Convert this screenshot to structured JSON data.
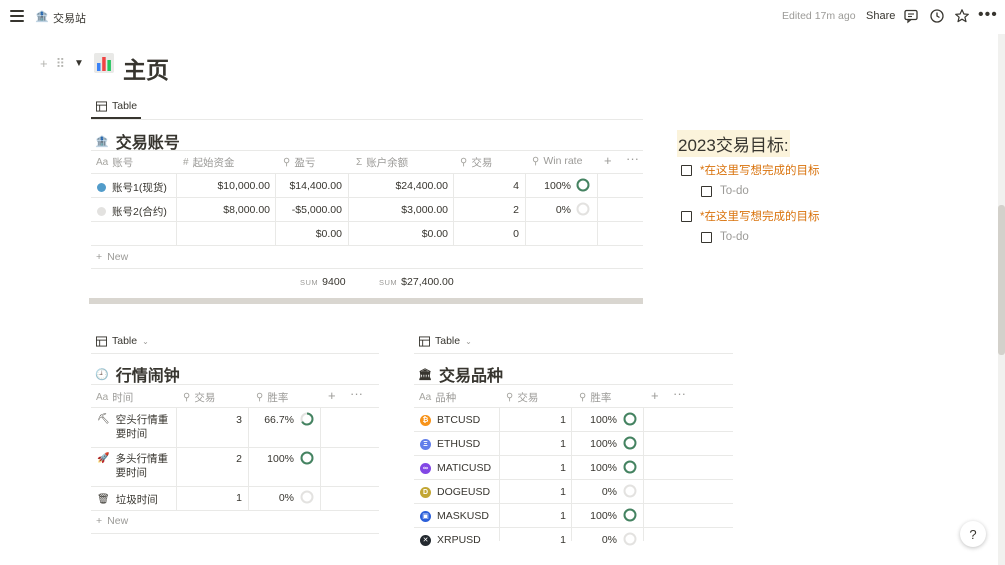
{
  "topbar": {
    "breadcrumb": "交易站",
    "edited": "Edited 17m ago",
    "share": "Share",
    "icons": [
      "menu-icon",
      "comment-icon",
      "clock-icon",
      "star-icon",
      "more-icon"
    ]
  },
  "page": {
    "icon": "bar-chart-icon",
    "title": "主页"
  },
  "accounts": {
    "view_label": "Table",
    "title": "交易账号",
    "columns": [
      "账号",
      "起始资金",
      "盈亏",
      "账户余额",
      "交易",
      "Win rate"
    ],
    "column_icons": [
      "Aa",
      "#",
      "search-icon",
      "Σ",
      "search-icon",
      "search-icon"
    ],
    "rows": [
      {
        "name": "账号1(现货)",
        "dot_color": "#529cca",
        "start": "$10,000.00",
        "pnl": "$14,400.00",
        "balance": "$24,400.00",
        "trades": "4",
        "winrate": "100%",
        "winrate_value": 1.0
      },
      {
        "name": "账号2(合约)",
        "dot_color": "#e3e2e0",
        "start": "$8,000.00",
        "pnl": "-$5,000.00",
        "balance": "$3,000.00",
        "trades": "2",
        "winrate": "0%",
        "winrate_value": 0.0
      },
      {
        "name": "",
        "dot_color": "",
        "start": "",
        "pnl": "$0.00",
        "balance": "$0.00",
        "trades": "0",
        "winrate": "",
        "winrate_value": null
      }
    ],
    "new_label": "New",
    "sum_label": "SUM",
    "sum_pnl": "9400",
    "sum_balance": "$27,400.00"
  },
  "alarms": {
    "view_label": "Table",
    "title": "行情闹钟",
    "columns": [
      "时间",
      "交易",
      "胜率"
    ],
    "rows": [
      {
        "icon": "hammer-icon",
        "name": "空头行情重要时间",
        "trades": "3",
        "winrate": "66.7%",
        "winrate_value": 0.667
      },
      {
        "icon": "rocket-icon",
        "name": "多头行情重要时间",
        "trades": "2",
        "winrate": "100%",
        "winrate_value": 1.0
      },
      {
        "icon": "trash-icon",
        "name": "垃圾时间",
        "trades": "1",
        "winrate": "0%",
        "winrate_value": 0.0
      }
    ],
    "new_label": "New"
  },
  "symbols": {
    "view_label": "Table",
    "title": "交易品种",
    "columns": [
      "品种",
      "交易",
      "胜率"
    ],
    "rows": [
      {
        "icon": "btc-icon",
        "color": "#f7931a",
        "glyph": "₿",
        "name": "BTCUSD",
        "trades": "1",
        "winrate": "100%",
        "winrate_value": 1.0
      },
      {
        "icon": "eth-icon",
        "color": "#627eea",
        "glyph": "Ξ",
        "name": "ETHUSD",
        "trades": "1",
        "winrate": "100%",
        "winrate_value": 1.0
      },
      {
        "icon": "matic-icon",
        "color": "#8247e5",
        "glyph": "∞",
        "name": "MATICUSD",
        "trades": "1",
        "winrate": "100%",
        "winrate_value": 1.0
      },
      {
        "icon": "doge-icon",
        "color": "#c2a633",
        "glyph": "D",
        "name": "DOGEUSD",
        "trades": "1",
        "winrate": "0%",
        "winrate_value": 0.0
      },
      {
        "icon": "mask-icon",
        "color": "#2b5fd9",
        "glyph": "▣",
        "name": "MASKUSD",
        "trades": "1",
        "winrate": "100%",
        "winrate_value": 1.0
      },
      {
        "icon": "xrp-icon",
        "color": "#23292f",
        "glyph": "✕",
        "name": "XRPUSD",
        "trades": "1",
        "winrate": "0%",
        "winrate_value": 0.0
      }
    ]
  },
  "goals": {
    "title": "2023交易目标:",
    "items": [
      {
        "text": "*在这里写想完成的目标",
        "sub": "To-do"
      },
      {
        "text": "*在这里写想完成的目标",
        "sub": "To-do"
      }
    ]
  },
  "help_label": "?",
  "colors": {
    "ring_full": "#448361",
    "ring_empty": "#e3e2e0",
    "goal_orange": "#d9730d",
    "goal_highlight": "#fbf3db"
  }
}
